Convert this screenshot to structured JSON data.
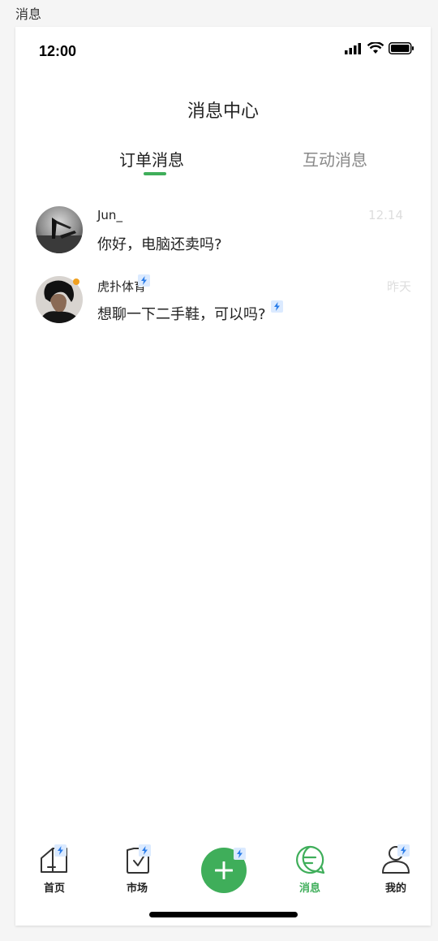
{
  "page_label": "消息",
  "status_bar": {
    "time": "12:00"
  },
  "header": {
    "title": "消息中心"
  },
  "tabs": [
    {
      "label": "订单消息",
      "active": true
    },
    {
      "label": "互动消息",
      "active": false
    }
  ],
  "messages": [
    {
      "name": "Jun_",
      "text": "你好，电脑还卖吗?",
      "time": "12.14",
      "unread": false
    },
    {
      "name": "虎扑体育",
      "text": "想聊一下二手鞋，可以吗?",
      "time": "昨天",
      "unread": true
    }
  ],
  "tabbar": {
    "items": [
      {
        "label": "首页",
        "icon": "home-icon"
      },
      {
        "label": "市场",
        "icon": "market-icon"
      },
      {
        "label": "",
        "icon": "plus-icon"
      },
      {
        "label": "消息",
        "icon": "message-icon",
        "active": true
      },
      {
        "label": "我的",
        "icon": "profile-icon"
      }
    ]
  },
  "colors": {
    "accent": "#3fae5a",
    "unread_dot": "#f0a020",
    "muted": "#888888"
  }
}
